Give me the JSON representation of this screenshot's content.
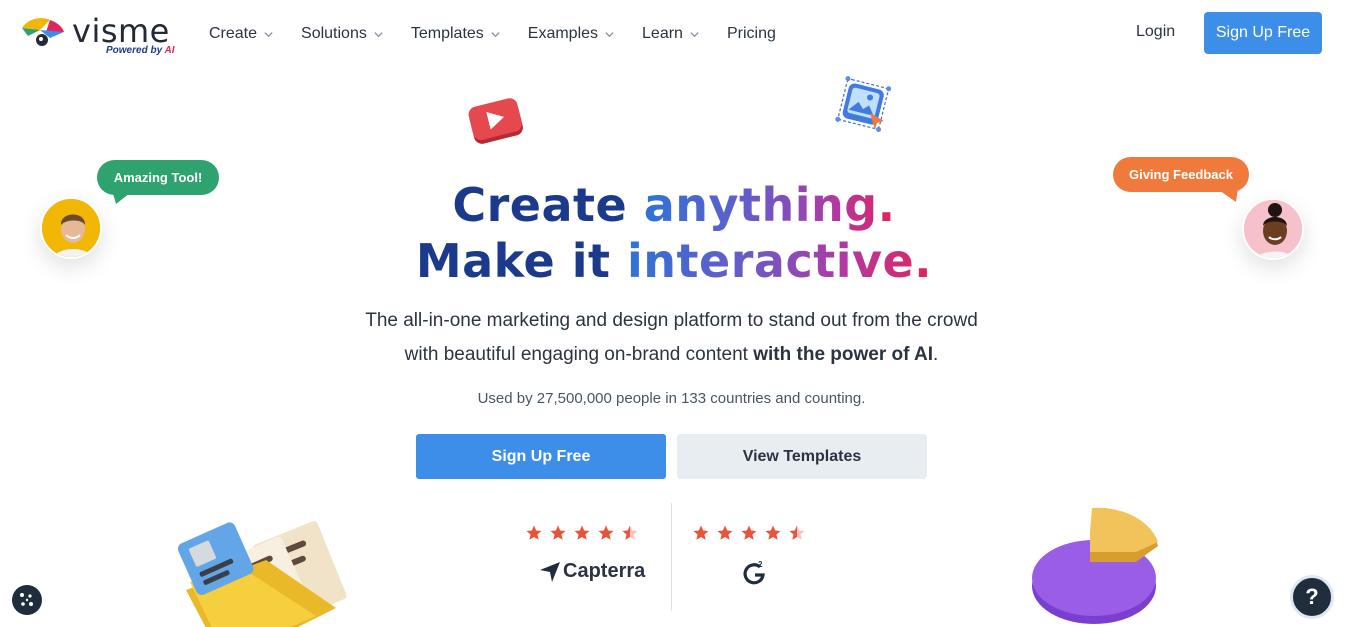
{
  "header": {
    "logo_word": "visme",
    "logo_tag_prefix": "Powered by ",
    "logo_tag_ai": "AI",
    "nav": [
      {
        "label": "Create",
        "has_dropdown": true
      },
      {
        "label": "Solutions",
        "has_dropdown": true
      },
      {
        "label": "Templates",
        "has_dropdown": true
      },
      {
        "label": "Examples",
        "has_dropdown": true
      },
      {
        "label": "Learn",
        "has_dropdown": true
      },
      {
        "label": "Pricing",
        "has_dropdown": false
      }
    ],
    "login_label": "Login",
    "signup_label": "Sign Up Free"
  },
  "hero": {
    "line1_a": "Create ",
    "line1_b": "anything.",
    "line2_a": "Make it ",
    "line2_b": "interactive.",
    "sub_line1": "The all-in-one marketing and design platform to stand out from the crowd",
    "sub_line2_a": "with beautiful engaging on-brand content ",
    "sub_line2_b": "with the power of AI",
    "sub_line2_c": ".",
    "used_by": "Used by 27,500,000 people in 133 countries and counting.",
    "primary_cta": "Sign Up Free",
    "secondary_cta": "View Templates"
  },
  "testimonials": {
    "left_bubble": "Amazing Tool!",
    "right_bubble": "Giving Feedback"
  },
  "ratings": [
    {
      "source": "Capterra",
      "stars": 4.5
    },
    {
      "source": "G2",
      "stars": 4.5
    }
  ],
  "help_label": "?",
  "colors": {
    "primary": "#3d8ee8",
    "navy": "#1b3a8c",
    "pink": "#e0245e",
    "star": "#e8533a",
    "bubble_green": "#2ea36f",
    "bubble_orange": "#f07a3c"
  },
  "icons": [
    "chevron-down-icon",
    "star-icon",
    "capterra-arrow-icon",
    "g2-icon",
    "cookie-icon",
    "help-icon",
    "play-icon",
    "image-icon",
    "folder-icon",
    "pie-chart-icon"
  ]
}
